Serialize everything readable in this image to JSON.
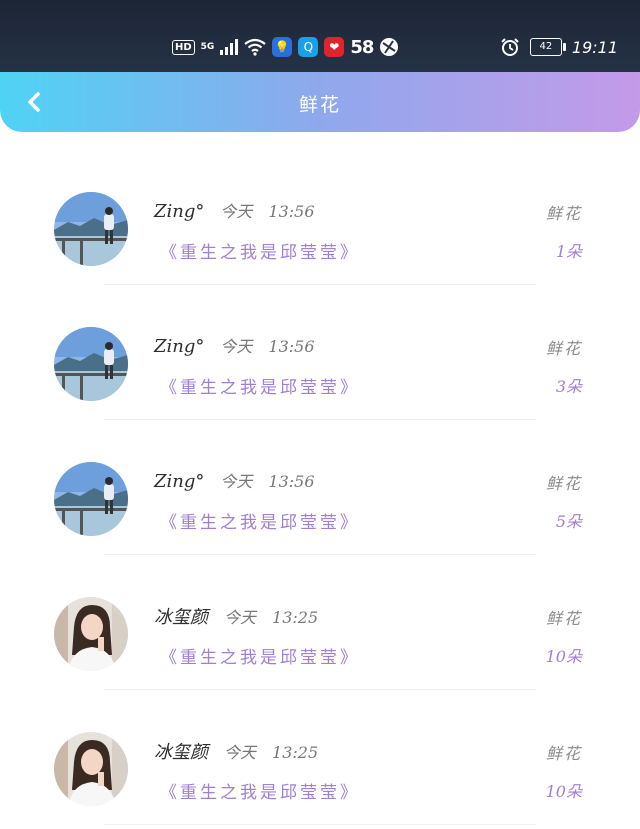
{
  "status_bar": {
    "hd": "HD",
    "network": "5G",
    "app_58": "58",
    "battery": "42",
    "time": "19:11"
  },
  "header": {
    "title": "鲜花"
  },
  "records": [
    {
      "name": "Zing°",
      "date": "今天",
      "time": "13:56",
      "book": "《重生之我是邱莹莹》",
      "gift": "鲜花",
      "count": "1朵",
      "avatar": "avatar-landscape"
    },
    {
      "name": "Zing°",
      "date": "今天",
      "time": "13:56",
      "book": "《重生之我是邱莹莹》",
      "gift": "鲜花",
      "count": "3朵",
      "avatar": "avatar-landscape"
    },
    {
      "name": "Zing°",
      "date": "今天",
      "time": "13:56",
      "book": "《重生之我是邱莹莹》",
      "gift": "鲜花",
      "count": "5朵",
      "avatar": "avatar-landscape"
    },
    {
      "name": "冰玺颜",
      "date": "今天",
      "time": "13:25",
      "book": "《重生之我是邱莹莹》",
      "gift": "鲜花",
      "count": "10朵",
      "avatar": "avatar-portrait"
    },
    {
      "name": "冰玺颜",
      "date": "今天",
      "time": "13:25",
      "book": "《重生之我是邱莹莹》",
      "gift": "鲜花",
      "count": "10朵",
      "avatar": "avatar-portrait"
    }
  ]
}
